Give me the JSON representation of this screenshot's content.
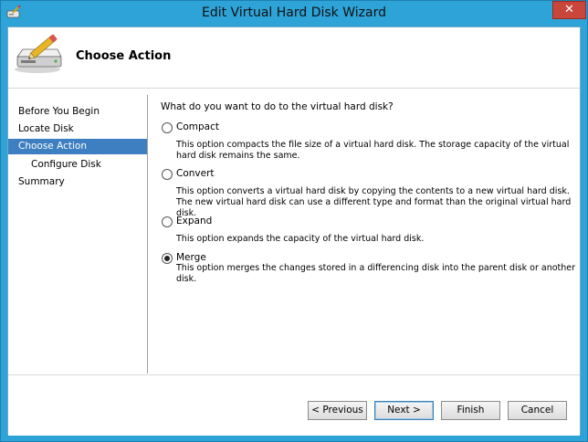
{
  "window": {
    "title": "Edit Virtual Hard Disk Wizard",
    "close_label": "✕"
  },
  "header": {
    "title": "Choose Action"
  },
  "nav": {
    "items": [
      {
        "label": "Before You Begin"
      },
      {
        "label": "Locate Disk"
      },
      {
        "label": "Choose Action"
      },
      {
        "label": "Configure Disk"
      },
      {
        "label": "Summary"
      }
    ]
  },
  "content": {
    "question": "What do you want to do to the virtual hard disk?",
    "options": [
      {
        "label": "Compact",
        "description": "This option compacts the file size of a virtual hard disk. The storage capacity of the virtual hard disk remains the same."
      },
      {
        "label": "Convert",
        "description": "This option converts a virtual hard disk by copying the contents to a new virtual hard disk. The new virtual hard disk can use a different type and format than the original virtual hard disk."
      },
      {
        "label": "Expand",
        "description": "This option expands the capacity of the virtual hard disk."
      },
      {
        "label": "Merge",
        "description": "This option merges the changes stored in a differencing disk into the parent disk or another disk."
      }
    ],
    "selected": "Merge"
  },
  "footer": {
    "previous_label": "< Previous",
    "next_label": "Next >",
    "finish_label": "Finish",
    "cancel_label": "Cancel"
  },
  "colors": {
    "titlebar": "#2ea3d8",
    "nav_active": "#3d7fc1",
    "close_button": "#c8463c"
  }
}
